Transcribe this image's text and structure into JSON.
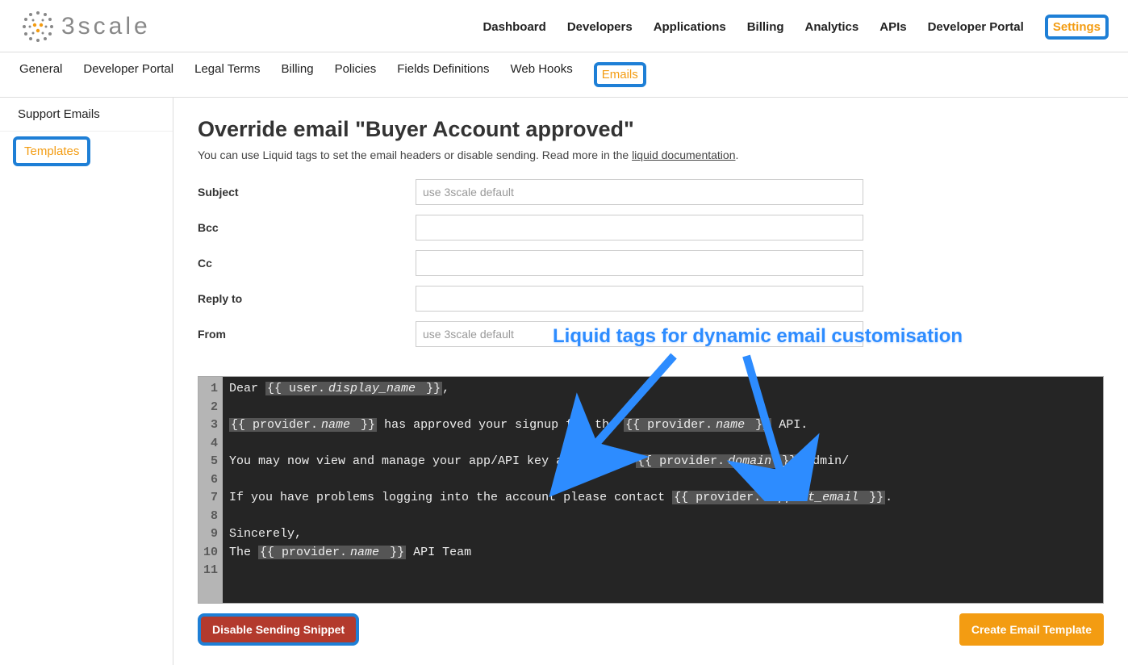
{
  "logo_text": "3scale",
  "main_nav": [
    "Dashboard",
    "Developers",
    "Applications",
    "Billing",
    "Analytics",
    "APIs",
    "Developer Portal",
    "Settings"
  ],
  "main_nav_active": "Settings",
  "sub_nav": [
    "General",
    "Developer Portal",
    "Legal Terms",
    "Billing",
    "Policies",
    "Fields Definitions",
    "Web Hooks",
    "Emails"
  ],
  "sub_nav_active": "Emails",
  "sidebar": [
    "Support Emails",
    "Templates"
  ],
  "sidebar_active": "Templates",
  "page_title": "Override email \"Buyer Account approved\"",
  "page_desc_prefix": "You can use Liquid tags to set the email headers or disable sending. Read more in the ",
  "page_desc_link": "liquid documentation",
  "page_desc_suffix": ".",
  "fields": {
    "subject": {
      "label": "Subject",
      "placeholder": "use 3scale default",
      "value": ""
    },
    "bcc": {
      "label": "Bcc",
      "placeholder": "",
      "value": ""
    },
    "cc": {
      "label": "Cc",
      "placeholder": "",
      "value": ""
    },
    "reply_to": {
      "label": "Reply to",
      "placeholder": "",
      "value": ""
    },
    "from": {
      "label": "From",
      "placeholder": "use 3scale default",
      "value": ""
    }
  },
  "annotation": "Liquid tags for dynamic email customisation",
  "editor_lines": [
    [
      {
        "t": "Dear "
      },
      {
        "tag": true,
        "t": "{{ user."
      },
      {
        "tag": true,
        "prop": true,
        "t": "display_name"
      },
      {
        "tag": true,
        "t": " }}"
      },
      {
        "t": ","
      }
    ],
    [],
    [
      {
        "tag": true,
        "t": "{{ provider."
      },
      {
        "tag": true,
        "prop": true,
        "t": "name"
      },
      {
        "tag": true,
        "t": " }}"
      },
      {
        "t": " has approved your signup for the "
      },
      {
        "tag": true,
        "t": "{{ provider."
      },
      {
        "tag": true,
        "prop": true,
        "t": "name"
      },
      {
        "tag": true,
        "t": " }}"
      },
      {
        "t": " API."
      }
    ],
    [],
    [
      {
        "t": "You may now view and manage your app/API key at https://"
      },
      {
        "tag": true,
        "t": "{{ provider."
      },
      {
        "tag": true,
        "prop": true,
        "t": "domain"
      },
      {
        "tag": true,
        "t": " }}"
      },
      {
        "t": "/admin/"
      }
    ],
    [],
    [
      {
        "t": "If you have problems logging into the account please contact "
      },
      {
        "tag": true,
        "t": "{{ provider."
      },
      {
        "tag": true,
        "prop": true,
        "t": "support_email"
      },
      {
        "tag": true,
        "t": " }}"
      },
      {
        "t": "."
      }
    ],
    [],
    [
      {
        "t": "Sincerely,"
      }
    ],
    [
      {
        "t": "The "
      },
      {
        "tag": true,
        "t": "{{ provider."
      },
      {
        "tag": true,
        "prop": true,
        "t": "name"
      },
      {
        "tag": true,
        "t": " }}"
      },
      {
        "t": " API Team"
      }
    ],
    []
  ],
  "buttons": {
    "disable": "Disable Sending Snippet",
    "create": "Create Email Template"
  }
}
